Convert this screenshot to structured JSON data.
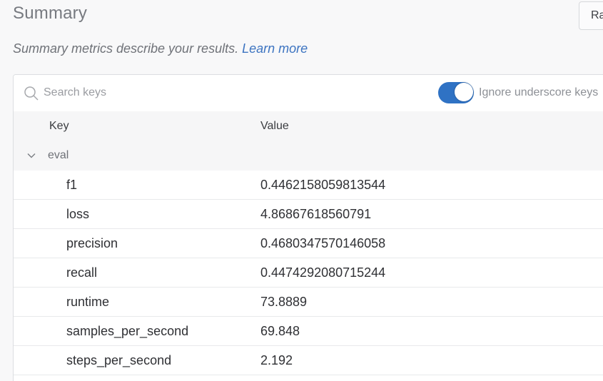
{
  "header": {
    "title": "Summary",
    "right_button_label": "Ra",
    "subtitle": "Summary metrics describe your results.",
    "learn_more": "Learn more"
  },
  "search": {
    "placeholder": "Search keys",
    "value": ""
  },
  "toggle": {
    "label": "Ignore underscore keys",
    "on": true,
    "color": "#2f72c4"
  },
  "table": {
    "columns": [
      "Key",
      "Value"
    ],
    "group": {
      "name": "eval",
      "expanded": true,
      "rows": [
        {
          "key": "f1",
          "value": "0.4462158059813544"
        },
        {
          "key": "loss",
          "value": "4.86867618560791"
        },
        {
          "key": "precision",
          "value": "0.4680347570146058"
        },
        {
          "key": "recall",
          "value": "0.4474292080715244"
        },
        {
          "key": "runtime",
          "value": "73.8889"
        },
        {
          "key": "samples_per_second",
          "value": "69.848"
        },
        {
          "key": "steps_per_second",
          "value": "2.192"
        }
      ]
    }
  },
  "icons": {
    "search": "search-icon",
    "expand": "chevron-down-icon"
  },
  "colors": {
    "link": "#3d74c1",
    "toggle_on": "#2f72c4"
  }
}
